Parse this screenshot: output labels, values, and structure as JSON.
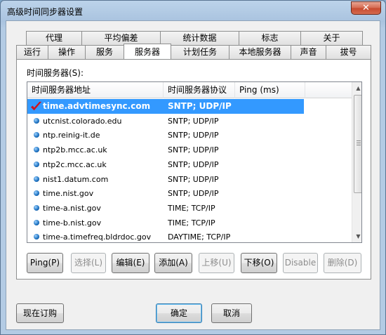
{
  "window": {
    "title": "高级时间同步器设置",
    "close_glyph": "✕"
  },
  "tabs_top": [
    "代理",
    "平均偏差",
    "统计数据",
    "标志",
    "关于"
  ],
  "tabs_bottom": [
    "运行",
    "操作",
    "服务",
    "服务器",
    "计划任务",
    "本地服务器",
    "声音",
    "拔号"
  ],
  "active_tab": "服务器",
  "panel": {
    "label": "时间服务器(S):"
  },
  "list": {
    "columns": [
      "时间服务器地址",
      "时间服务器协议",
      "Ping (ms)"
    ],
    "rows": [
      {
        "address": "time.advtimesync.com",
        "protocol": "SNTP; UDP/IP",
        "selected": true,
        "icon": "red-check-icon"
      },
      {
        "address": "utcnist.colorado.edu",
        "protocol": "SNTP; UDP/IP",
        "icon": "server-dot-icon"
      },
      {
        "address": "ntp.reinig-it.de",
        "protocol": "SNTP; UDP/IP",
        "icon": "server-dot-icon"
      },
      {
        "address": "ntp2b.mcc.ac.uk",
        "protocol": "SNTP; UDP/IP",
        "icon": "server-dot-icon"
      },
      {
        "address": "ntp2c.mcc.ac.uk",
        "protocol": "SNTP; UDP/IP",
        "icon": "server-dot-icon"
      },
      {
        "address": "nist1.datum.com",
        "protocol": "SNTP; UDP/IP",
        "icon": "server-dot-icon"
      },
      {
        "address": "time.nist.gov",
        "protocol": "SNTP; UDP/IP",
        "icon": "server-dot-icon"
      },
      {
        "address": "time-a.nist.gov",
        "protocol": "TIME; TCP/IP",
        "icon": "server-dot-icon"
      },
      {
        "address": "time-b.nist.gov",
        "protocol": "TIME; TCP/IP",
        "icon": "server-dot-icon"
      },
      {
        "address": "time-a.timefreq.bldrdoc.gov",
        "protocol": "DAYTIME; TCP/IP",
        "icon": "server-dot-icon"
      }
    ]
  },
  "actions": {
    "ping": "Ping(P)",
    "select": "选择(L)",
    "edit": "编辑(E)",
    "add": "添加(A)",
    "move_up": "上移(U)",
    "move_down": "下移(O)",
    "disable": "Disable",
    "delete": "删除(D)"
  },
  "footer": {
    "subscribe": "现在订购",
    "ok": "确定",
    "cancel": "取消"
  },
  "colors": {
    "selection": "#3399ff",
    "accent_check": "#d0121b"
  }
}
